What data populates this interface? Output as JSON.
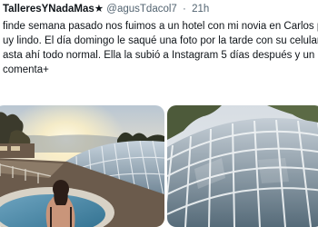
{
  "tweet": {
    "display_name": "TalleresYNadaMas★",
    "handle": "@agusTdacol7",
    "separator": "·",
    "time": "21h",
    "lines": [
      " finde semana pasado nos fuimos a un hotel con mi novia en Carlos p",
      "uy lindo. El día domingo le saqué una foto por la tarde con su celular,",
      "asta ahí todo normal. Ella la subió a Instagram 5 días después y un cha",
      "comenta+"
    ]
  },
  "photos": [
    {
      "icon": "hotel-pool-sunset-photo"
    },
    {
      "icon": "glass-dome-pool-photo"
    }
  ]
}
